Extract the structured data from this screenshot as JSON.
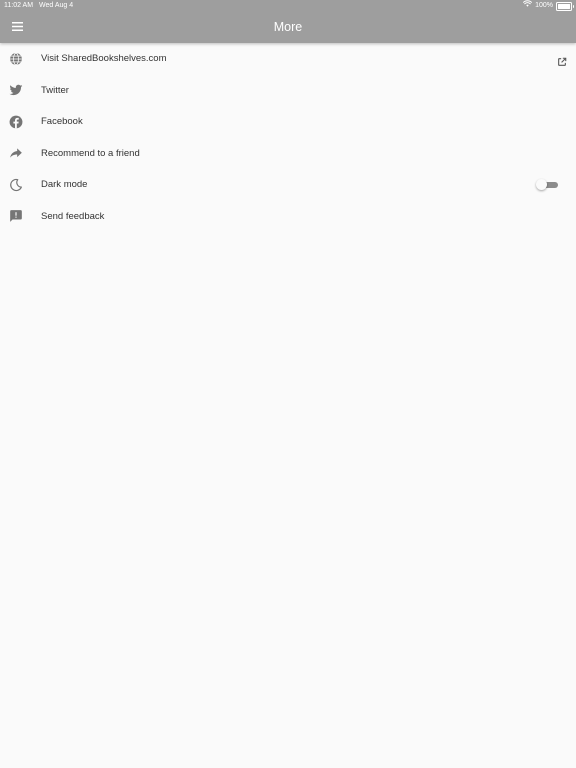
{
  "status_bar": {
    "time": "11:02 AM",
    "date": "Wed Aug 4",
    "battery_text": "100%",
    "battery_level": 1.0,
    "icons": [
      "wifi-icon",
      "battery-icon"
    ]
  },
  "app_bar": {
    "title": "More",
    "menu_icon": "menu-icon",
    "background_color": "#9e9e9e"
  },
  "items": [
    {
      "label": "Visit SharedBookshelves.com",
      "icon": "globe-icon",
      "trailing": "external-link-icon"
    },
    {
      "label": "Twitter",
      "icon": "twitter-icon"
    },
    {
      "label": "Facebook",
      "icon": "facebook-icon"
    },
    {
      "label": "Recommend to a friend",
      "icon": "share-arrow-icon"
    },
    {
      "label": "Dark mode",
      "icon": "moon-icon",
      "trailing": "toggle",
      "toggle_on": false
    },
    {
      "label": "Send feedback",
      "icon": "feedback-icon"
    }
  ],
  "colors": {
    "background": "#fafafa",
    "text": "#333333",
    "icon": "#757575",
    "header": "#9e9e9e",
    "toggle_track": "#8c8c8c"
  }
}
